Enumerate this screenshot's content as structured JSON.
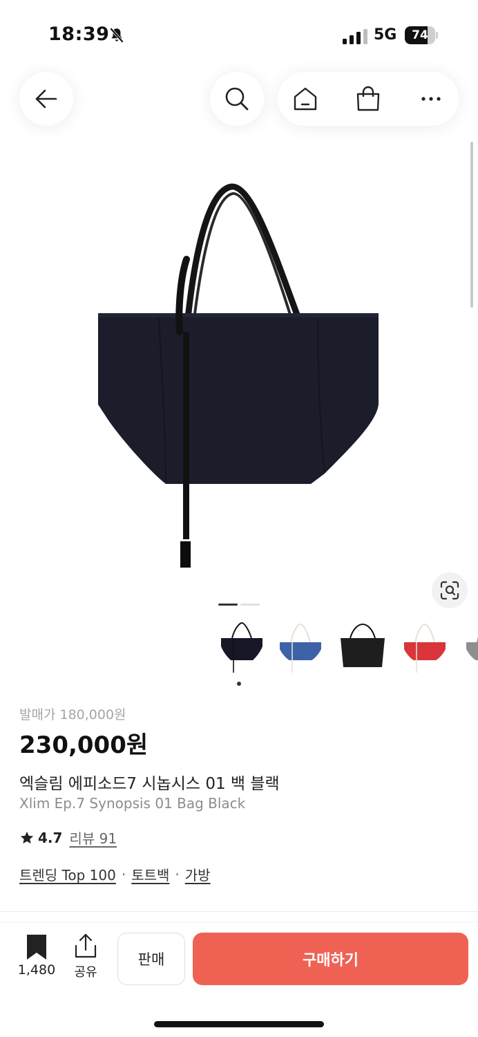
{
  "status_bar": {
    "time": "18:39",
    "silent_icon": "bell-slash-icon",
    "network": "5G",
    "battery_level": 74,
    "battery_text": "74"
  },
  "header": {
    "back_icon": "arrow-left-icon",
    "search_icon": "search-icon",
    "home_icon": "home-icon",
    "shop_icon": "shopping-bag-icon",
    "more_icon": "more-icon"
  },
  "gallery": {
    "page_count": 2,
    "current_page": 1,
    "lens_icon": "visual-search-icon",
    "thumbnails": [
      {
        "color": "black",
        "selected": true
      },
      {
        "color": "blue",
        "selected": false
      },
      {
        "color": "black",
        "selected": false
      },
      {
        "color": "red",
        "selected": false
      },
      {
        "color": "gray",
        "selected": false
      }
    ]
  },
  "product": {
    "release_price": "발매가 180,000원",
    "price": "230,000원",
    "name_ko": "엑슬림 에피소드7 시놉시스 01 백 블랙",
    "name_en": "Xlim Ep.7 Synopsis 01 Bag Black",
    "rating": "4.7",
    "review_label": "리뷰 91",
    "tags": [
      "트렌딩 Top 100",
      "토트백",
      "가방"
    ],
    "tag_separator": "·"
  },
  "bottom_bar": {
    "bookmark_count": "1,480",
    "share_label": "공유",
    "sell_label": "판매",
    "buy_label": "구매하기"
  },
  "colors": {
    "accent": "#ef6253",
    "bag_navy": "#1b1d2b"
  }
}
